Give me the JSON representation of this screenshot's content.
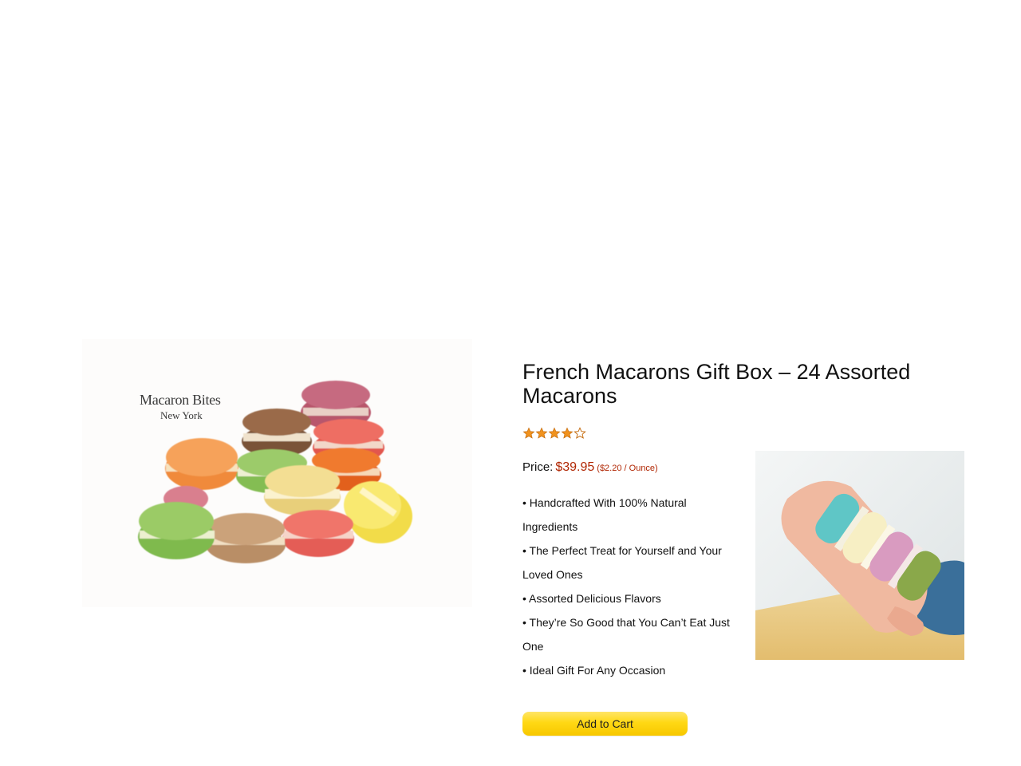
{
  "product": {
    "brand": {
      "name": "Macaron Bites",
      "city": "New York"
    },
    "title": "French Macarons Gift Box – 24 Assorted Macarons",
    "rating": {
      "stars_filled": 4,
      "stars_total": 5
    },
    "price": {
      "label": "Price:",
      "value": "$39.95",
      "unit_price": "($2.20 / Ounce)"
    },
    "bullets": [
      "• Handcrafted With 100% Natural Ingredients",
      "• The Perfect Treat for Yourself and Your Loved Ones",
      "• Assorted Delicious Flavors",
      "• They’re So Good that You Can’t Eat Just One",
      "• Ideal Gift For Any Occasion"
    ],
    "add_to_cart_label": "Add to Cart"
  },
  "colors": {
    "price": "#B12704",
    "star": "#F0921E",
    "button": "#FFD814"
  },
  "icons": {
    "star_filled": "star-icon",
    "star_empty": "star-outline-icon"
  }
}
